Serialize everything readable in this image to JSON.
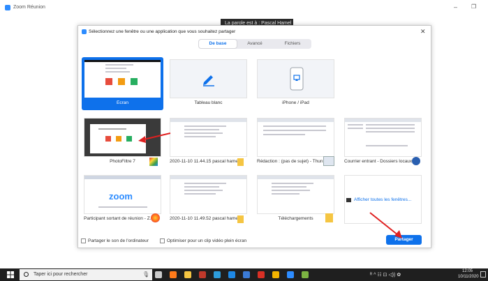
{
  "app": {
    "title": "Zoom Réunion",
    "minimize_glyph": "–",
    "maximize_glyph": "❐"
  },
  "speaker_banner": "La parole est à : Pascal Hamel",
  "dialog": {
    "title": "Sélectionnez une fenêtre ou une application que vous souhaitez partager",
    "close_glyph": "✕",
    "tabs": [
      {
        "label": "De base",
        "active": true
      },
      {
        "label": "Avancé",
        "active": false
      },
      {
        "label": "Fichiers",
        "active": false
      }
    ],
    "tiles": [
      {
        "label": "Écran",
        "selected": true,
        "icon": "screen-thumbnail"
      },
      {
        "label": "Tableau blanc",
        "selected": false,
        "icon": "pencil-icon"
      },
      {
        "label": "iPhone / iPad",
        "selected": false,
        "icon": "ipad-icon"
      },
      {
        "label": "",
        "selected": false,
        "icon": "blank"
      },
      {
        "label": "PhotoFiltre 7",
        "selected": false,
        "icon": "photofiltre-icon"
      },
      {
        "label": "2020-11-10 11.44.15 pascal hamel...",
        "selected": false,
        "icon": "folder-icon"
      },
      {
        "label": "Rédaction : (pas de sujet) - Thun...",
        "selected": false,
        "icon": "thunderbird-icon"
      },
      {
        "label": "Courrier entrant - Dossiers locaux...",
        "selected": false,
        "icon": "thunderbird-icon"
      },
      {
        "label": "Participant sortant de réunion - Z...",
        "selected": false,
        "icon": "firefox-icon",
        "thumb_text": "zoom"
      },
      {
        "label": "2020-11-10 11.49.52 pascal hamel...",
        "selected": false,
        "icon": "folder-icon"
      },
      {
        "label": "Téléchargements",
        "selected": false,
        "icon": "download-folder-icon"
      },
      {
        "label": "Afficher toutes les fenêtres...",
        "selected": false,
        "icon": "windows-icon",
        "is_link": true
      }
    ],
    "checkbox_sound": "Partager le son de l'ordinateur",
    "checkbox_video": "Optimiser pour un clip vidéo plein écran",
    "share_button": "Partager"
  },
  "taskbar": {
    "search_placeholder": "Taper ici pour rechercher",
    "clock_time": "12:05",
    "clock_date": "10/11/2020",
    "tray_glyphs": "ᴿ ^ ☷ ⊡ ◁)) ✿",
    "apps": [
      {
        "name": "task-view-icon",
        "color": "#cccccc"
      },
      {
        "name": "firefox-icon",
        "color": "#ff7a1a"
      },
      {
        "name": "file-explorer-icon",
        "color": "#f5c542"
      },
      {
        "name": "filezilla-icon",
        "color": "#c0392b"
      },
      {
        "name": "notes-icon",
        "color": "#2d9cdb"
      },
      {
        "name": "edge-icon",
        "color": "#1e88e5"
      },
      {
        "name": "thunderbird-icon",
        "color": "#3b7bd6"
      },
      {
        "name": "acrobat-icon",
        "color": "#d93025"
      },
      {
        "name": "chrome-icon",
        "color": "#f4b400"
      },
      {
        "name": "zoom-icon",
        "color": "#2D8CFF"
      },
      {
        "name": "photofiltre-icon",
        "color": "#7cb342"
      }
    ]
  },
  "colors": {
    "accent": "#0e71eb",
    "arrow": "#e02020",
    "zoom_blue": "#2D8CFF"
  }
}
